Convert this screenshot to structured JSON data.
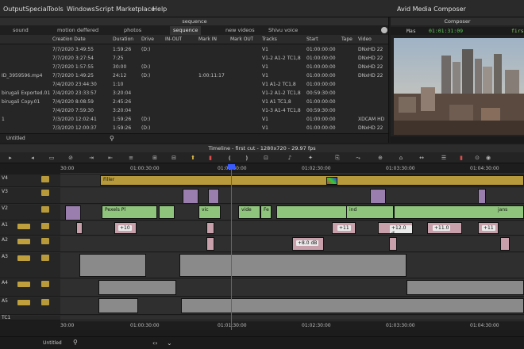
{
  "menu": {
    "items": [
      "Output",
      "Special",
      "Tools",
      "Windows",
      "Script",
      "Marketplace",
      "Help"
    ],
    "app_title": "Avid Media Composer"
  },
  "bin": {
    "title": "sequence",
    "tabs": [
      "sound",
      "motion deffered",
      "photos",
      "sequence",
      "new videos",
      "Shivu voice"
    ],
    "selected_tab": "sequence",
    "columns": [
      "Creation Date",
      "Duration",
      "Drive",
      "IN-OUT",
      "Mark IN",
      "Mark OUT",
      "Tracks",
      "Start",
      "Tape",
      "Video"
    ],
    "rows": [
      {
        "name": "",
        "created": "7/7/2020 3:49:55",
        "duration": "1:59:26",
        "drive": "(D:)",
        "inout": "",
        "markin": "",
        "markout": "",
        "tracks": "V1",
        "start": "01:00:00:00",
        "tape": "",
        "video": "DNxHD 22"
      },
      {
        "name": "",
        "created": "7/7/2020 3:27:54",
        "duration": "7:25",
        "drive": "",
        "inout": "",
        "markin": "",
        "markout": "",
        "tracks": "V1-2 A1-2 TC1,8",
        "start": "01:00:00:00",
        "tape": "",
        "video": "DNxHD 22"
      },
      {
        "name": "",
        "created": "7/7/2020 1:57:55",
        "duration": "30:00",
        "drive": "(D:)",
        "inout": "",
        "markin": "",
        "markout": "",
        "tracks": "V1",
        "start": "01:00:00:00",
        "tape": "",
        "video": "DNxHD 22"
      },
      {
        "name": "ID_3959596.mp4",
        "created": "7/7/2020 1:49:25",
        "duration": "24:12",
        "drive": "(D:)",
        "inout": "",
        "markin": "1:00:11:17",
        "markout": "",
        "tracks": "V1",
        "start": "01:00:00:00",
        "tape": "",
        "video": "DNxHD 22"
      },
      {
        "name": "",
        "created": "7/4/2020 23:44:30",
        "duration": "1:10",
        "drive": "",
        "inout": "",
        "markin": "",
        "markout": "",
        "tracks": "V1 A1-2 TC1,8",
        "start": "01:00:00:00",
        "tape": "",
        "video": ""
      },
      {
        "name": "birugali Exported.01",
        "created": "7/4/2020 23:33:57",
        "duration": "3:20:04",
        "drive": "",
        "inout": "",
        "markin": "",
        "markout": "",
        "tracks": "V1-2 A1-2 TC1,8",
        "start": "00:59:30:00",
        "tape": "",
        "video": ""
      },
      {
        "name": "birugali Copy.01",
        "created": "7/4/2020 8:08:59",
        "duration": "2:45:26",
        "drive": "",
        "inout": "",
        "markin": "",
        "markout": "",
        "tracks": "V1 A1 TC1,8",
        "start": "01:00:00:00",
        "tape": "",
        "video": ""
      },
      {
        "name": "",
        "created": "7/4/2020 7:59:30",
        "duration": "3:20:04",
        "drive": "",
        "inout": "",
        "markin": "",
        "markout": "",
        "tracks": "V1-3 A1-4 TC1,8",
        "start": "00:59:30:00",
        "tape": "",
        "video": ""
      },
      {
        "name": "1",
        "created": "7/3/2020 12:02:41",
        "duration": "1:59:26",
        "drive": "(D:)",
        "inout": "",
        "markin": "",
        "markout": "",
        "tracks": "V1",
        "start": "01:00:00:00",
        "tape": "",
        "video": "XDCAM HD"
      },
      {
        "name": "",
        "created": "7/3/2020 12:00:37",
        "duration": "1:59:26",
        "drive": "(D:)",
        "inout": "",
        "markin": "",
        "markout": "",
        "tracks": "V1",
        "start": "01:00:00:00",
        "tape": "",
        "video": "DNxHD 22"
      }
    ],
    "footer_label": "Untitled"
  },
  "composer": {
    "title": "Composer",
    "mode": "Mas",
    "timecode": "01:01:31:09",
    "extra": "firs"
  },
  "timeline": {
    "title": "Timeline - first cut - 1280x720 - 29.97 fps",
    "ruler_ticks": [
      "30:00",
      "01:00:30:00",
      "01:01:30:00",
      "01:02:30:00",
      "01:03:30:00",
      "01:04:30:00"
    ],
    "tracks": [
      "V4",
      "V3",
      "V2",
      "A1",
      "A2",
      "A3",
      "A4",
      "A5",
      "TC1"
    ],
    "filler_label": "Filler",
    "clip_labels": [
      "Pexels Pl",
      "vic",
      "vide",
      "Fe",
      "ind",
      "jans"
    ],
    "gains": [
      "+10",
      "+8.0 dB",
      "+11",
      "+12.0 d",
      "+11.0",
      "+11"
    ],
    "status_label": "Untitled"
  },
  "colors": {
    "filler": "#b79a3b",
    "video_clip": "#9a7fae",
    "green_clip": "#8fc47c",
    "audio_clip": "#8a8a8a",
    "playhead": "#3a5cff",
    "timecode": "#5fd05a"
  }
}
